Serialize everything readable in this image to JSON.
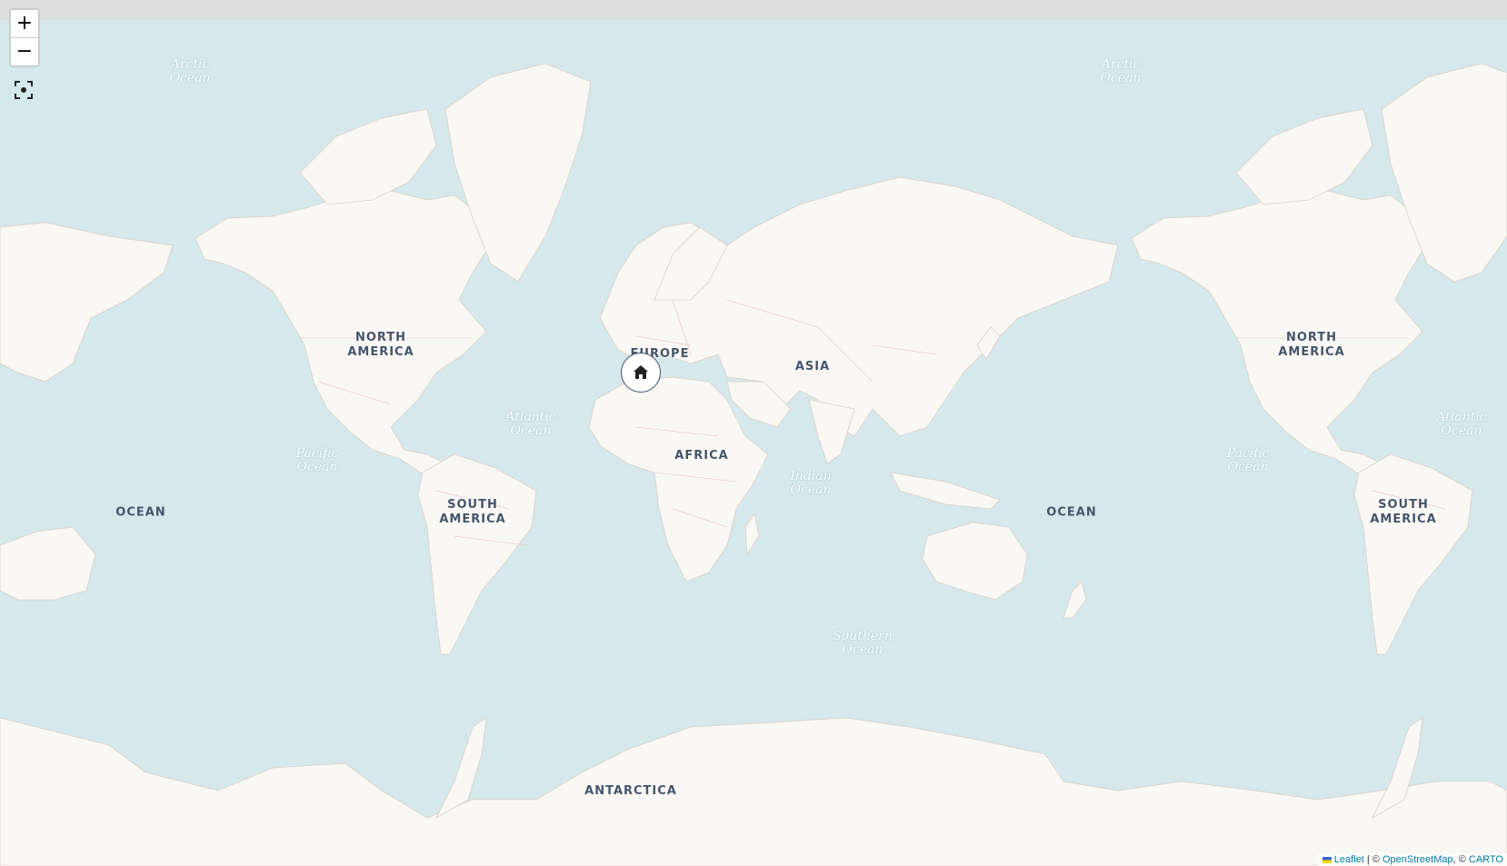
{
  "controls": {
    "zoom_in_label": "+",
    "zoom_out_label": "−"
  },
  "labels": {
    "north_america": "NORTH\nAMERICA",
    "north_america_2": "NORTH\nAMERICA",
    "south_america": "SOUTH\nAMERICA",
    "south_america_2": "SOUTH\nAMERICA",
    "europe": "EUROPE",
    "asia": "ASIA",
    "africa": "AFRICA",
    "antarctica": "ANTARCTICA",
    "arctic_ocean": "Arctic\nOcean",
    "arctic_ocean_2": "Arctic\nOcean",
    "atlantic_ocean": "Atlantic\nOcean",
    "atlantic_ocean_2": "Atlantic\nOcean",
    "pacific_ocean": "Pacific\nOcean",
    "pacific_ocean_2": "Pacific\nOcean",
    "indian_ocean": "Indian\nOcean",
    "southern_ocean": "Southern\nOcean",
    "ocean_left": "OCEAN",
    "ocean_right": "OCEAN"
  },
  "marker": {
    "icon": "home-icon"
  },
  "attribution": {
    "leaflet": "Leaflet",
    "separator": " | © ",
    "osm": "OpenStreetMap",
    "sep2": ", © ",
    "carto": "CARTO"
  },
  "colors": {
    "water": "#d5e8eb",
    "land": "#faf8f5",
    "border": "#e8c9cc",
    "label": "#44546a",
    "link": "#0078a8"
  }
}
